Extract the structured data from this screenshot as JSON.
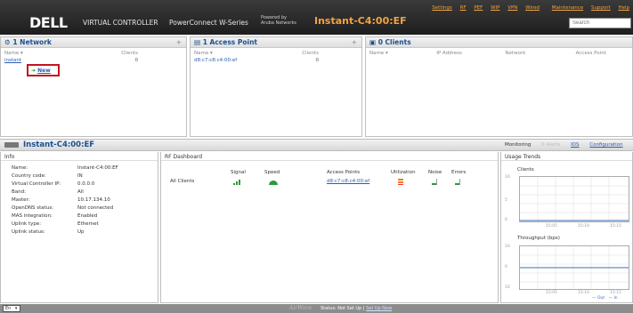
{
  "header": {
    "logo": "DELL",
    "virtual_controller": "VIRTUAL CONTROLLER",
    "powerconnect": "PowerConnect W-Series",
    "powered_line1": "Powered by",
    "powered_line2": "Aruba Networks",
    "instant_name": "Instant-C4:00:EF",
    "links": [
      "Settings",
      "RF",
      "PEF",
      "WIP",
      "VPN",
      "Wired",
      "Maintenance",
      "Support",
      "Help"
    ],
    "search_placeholder": "Search"
  },
  "networks": {
    "title": "1 Network",
    "plus": "+",
    "col_name": "Name",
    "col_clients": "Clients",
    "row_name": "instant",
    "row_clients": "0",
    "new_label": "New"
  },
  "access_points": {
    "title": "1 Access Point",
    "plus": "+",
    "col_name": "Name",
    "col_clients": "Clients",
    "row_name": "d8:c7:c8:c4:00:ef",
    "row_clients": "0"
  },
  "clients": {
    "title": "0 Clients",
    "col_name": "Name",
    "col_ip": "IP Address",
    "col_network": "Network",
    "col_ap": "Access Point"
  },
  "instant_bar": {
    "name": "Instant-C4:00:EF",
    "monitoring": "Monitoring",
    "alerts": "0 Alerts",
    "ids": "IDS",
    "configuration": "Configuration"
  },
  "info": {
    "title": "Info",
    "rows": [
      {
        "k": "Name:",
        "v": "Instant-C4:00:EF"
      },
      {
        "k": "Country code:",
        "v": "IN"
      },
      {
        "k": "Virtual Controller IP:",
        "v": "0.0.0.0"
      },
      {
        "k": "Band:",
        "v": "All"
      },
      {
        "k": "Master:",
        "v": "10.17.134.10"
      },
      {
        "k": "OpenDNS status:",
        "v": "Not connected"
      },
      {
        "k": "MAS integration:",
        "v": "Enabled"
      },
      {
        "k": "Uplink type:",
        "v": "Ethernet"
      },
      {
        "k": "Uplink status:",
        "v": "Up"
      }
    ]
  },
  "rf": {
    "title": "RF Dashboard",
    "headers": [
      "Signal",
      "Speed",
      "Access Points",
      "Utilization",
      "Noise",
      "Errors"
    ],
    "row_label": "All Clients",
    "ap_link": "d8:c7:c8:c4:00:ef"
  },
  "usage": {
    "title": "Usage Trends",
    "clients_label": "Clients",
    "clients_y": [
      "10",
      "5",
      "0"
    ],
    "throughput_label": "Throughput  (bps)",
    "throughput_y": [
      "10",
      "0",
      "10"
    ],
    "x_ticks": [
      "15:05",
      "15:10",
      "15:15"
    ],
    "legend_out": "Out",
    "legend_in": "In"
  },
  "footer": {
    "lang": "En",
    "airwave": "AirWave",
    "status": "Status: Not Set Up",
    "sep": "|",
    "setup_link": "Set Up Now"
  },
  "colors": {
    "accent_orange": "#f2a341",
    "link_blue": "#2a5db0",
    "new_border": "#c0161f"
  }
}
